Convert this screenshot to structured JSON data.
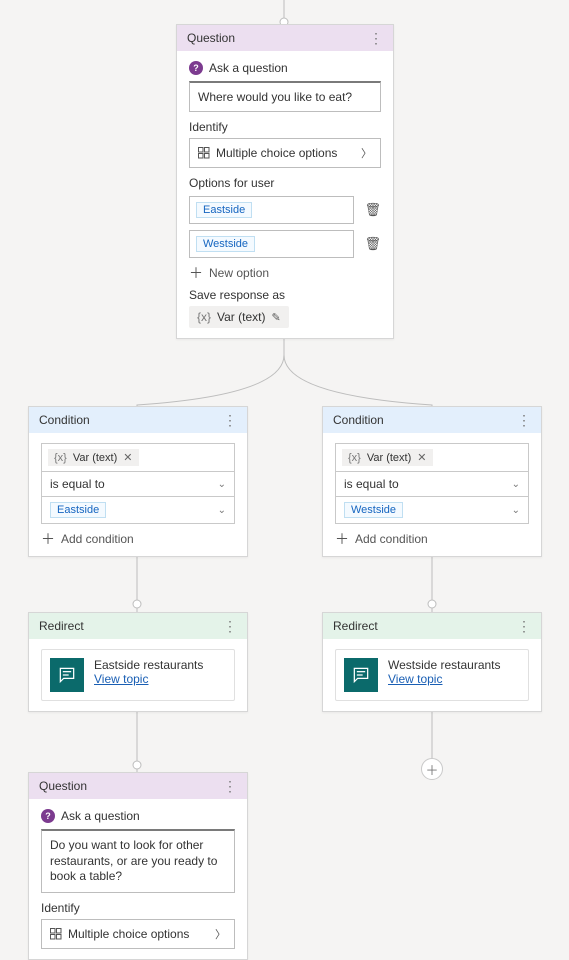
{
  "strings": {
    "ask_a_question": "Ask a question",
    "identify": "Identify",
    "options_for_user": "Options for user",
    "new_option": "New option",
    "save_response_as": "Save response as",
    "add_condition": "Add condition",
    "view_topic": "View topic"
  },
  "identifyType": "Multiple choice options",
  "question1": {
    "header": "Question",
    "text": "Where would you like to eat?",
    "options": [
      "Eastside",
      "Westside"
    ],
    "variable": "Var (text)"
  },
  "condition1": {
    "header": "Condition",
    "variable": "Var (text)",
    "operator": "is equal to",
    "value": "Eastside"
  },
  "condition2": {
    "header": "Condition",
    "variable": "Var (text)",
    "operator": "is equal to",
    "value": "Westside"
  },
  "redirect1": {
    "header": "Redirect",
    "title": "Eastside restaurants"
  },
  "redirect2": {
    "header": "Redirect",
    "title": "Westside restaurants"
  },
  "question2": {
    "header": "Question",
    "text": "Do you want to look for other restaurants, or are you ready to book a table?"
  }
}
